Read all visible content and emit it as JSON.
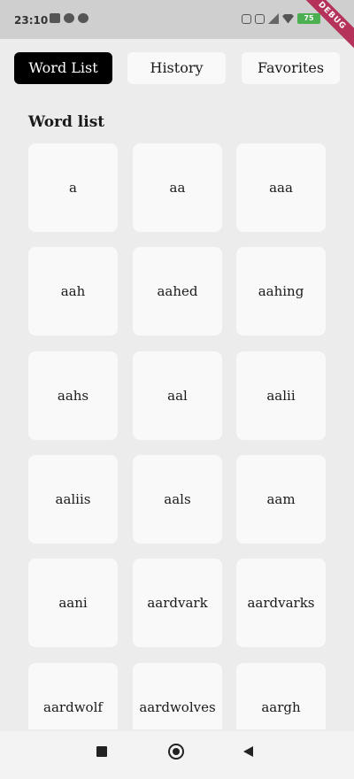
{
  "status_bar": {
    "time": "23:10",
    "battery": "75",
    "debug_label": "DEBUG"
  },
  "tabs": [
    {
      "label": "Word List",
      "active": true
    },
    {
      "label": "History",
      "active": false
    },
    {
      "label": "Favorites",
      "active": false
    }
  ],
  "section_title": "Word list",
  "words": [
    "a",
    "aa",
    "aaa",
    "aah",
    "aahed",
    "aahing",
    "aahs",
    "aal",
    "aalii",
    "aaliis",
    "aals",
    "aam",
    "aani",
    "aardvark",
    "aardvarks",
    "aardwolf",
    "aardwolves",
    "aargh"
  ],
  "icons": {
    "status_left": [
      "video-icon",
      "sync-icon",
      "at-icon"
    ],
    "status_right": [
      "alarm-icon",
      "screenshot-icon",
      "signal-icon",
      "wifi-icon",
      "battery-icon"
    ],
    "navigation": [
      "recents-square-icon",
      "home-circle-icon",
      "back-triangle-icon"
    ]
  },
  "colors": {
    "active_tab_bg": "#000000",
    "active_tab_text": "#ffffff",
    "card_bg": "#f9f9f9",
    "page_bg": "#ececec",
    "battery": "#4caf50",
    "debug_ribbon": "#b5325a"
  }
}
